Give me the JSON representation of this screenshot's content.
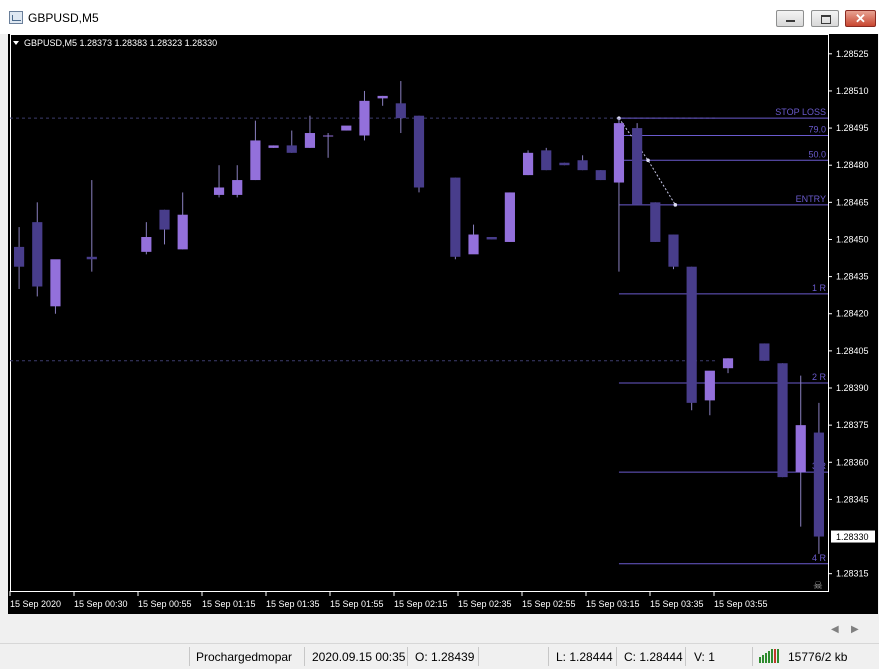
{
  "window": {
    "title": "GBPUSD,M5"
  },
  "symbol_info": "GBPUSD,M5  1.28373 1.28383 1.28323 1.28330",
  "colors": {
    "bg": "#000000",
    "bull": "#9370db",
    "bear": "#483d8b",
    "wick": "#8a80c0",
    "fib": "#6a5acd",
    "axis": "#ffffff",
    "grid": "#3c3c6e"
  },
  "status": {
    "profile": "Prochargedmopar",
    "datetime": "2020.09.15 00:35",
    "open": "O: 1.28439",
    "high": "",
    "low": "L: 1.28444",
    "close": "C: 1.28444",
    "volume": "V: 1",
    "traffic": "15776/2 kb"
  },
  "chart_data": {
    "type": "candlestick",
    "ylim": [
      1.28308,
      1.28533
    ],
    "y_ticks": [
      "1.28525",
      "1.28510",
      "1.28495",
      "1.28480",
      "1.28465",
      "1.28450",
      "1.28435",
      "1.28420",
      "1.28405",
      "1.28390",
      "1.28375",
      "1.28360",
      "1.28345",
      "1.28315"
    ],
    "current_price": "1.28330",
    "x_labels": [
      "15 Sep 2020",
      "15 Sep 00:30",
      "15 Sep 00:55",
      "15 Sep 01:15",
      "15 Sep 01:35",
      "15 Sep 01:55",
      "15 Sep 02:15",
      "15 Sep 02:35",
      "15 Sep 02:55",
      "15 Sep 03:15",
      "15 Sep 03:35",
      "15 Sep 03:55"
    ],
    "bar_count": 45,
    "candles": [
      [
        0,
        1.28447,
        1.28455,
        1.2843,
        1.28439
      ],
      [
        1,
        1.28457,
        1.28465,
        1.28427,
        1.28431
      ],
      [
        2,
        1.28423,
        1.28426,
        1.2842,
        1.28442
      ],
      [
        4,
        1.28443,
        1.28474,
        1.28437,
        1.28442
      ],
      [
        7,
        1.28445,
        1.28457,
        1.28444,
        1.28451
      ],
      [
        8,
        1.28462,
        1.28462,
        1.28448,
        1.28454
      ],
      [
        9,
        1.28446,
        1.28469,
        1.28446,
        1.2846
      ],
      [
        11,
        1.28468,
        1.2848,
        1.28467,
        1.28471
      ],
      [
        12,
        1.28468,
        1.2848,
        1.28467,
        1.28474
      ],
      [
        13,
        1.28474,
        1.28498,
        1.28474,
        1.2849
      ],
      [
        14,
        1.28487,
        1.28488,
        1.28487,
        1.28488
      ],
      [
        15,
        1.28488,
        1.28494,
        1.28485,
        1.28485
      ],
      [
        16,
        1.28487,
        1.285,
        1.28487,
        1.28493
      ],
      [
        17,
        1.28492,
        1.28493,
        1.28483,
        1.28492
      ],
      [
        18,
        1.28494,
        1.28495,
        1.28494,
        1.28496
      ],
      [
        19,
        1.28492,
        1.2851,
        1.2849,
        1.28506
      ],
      [
        20,
        1.28507,
        1.28508,
        1.28504,
        1.28508
      ],
      [
        21,
        1.28505,
        1.28514,
        1.28493,
        1.28499
      ],
      [
        22,
        1.285,
        1.285,
        1.28469,
        1.28471
      ],
      [
        24,
        1.28475,
        1.28475,
        1.28442,
        1.28443
      ],
      [
        25,
        1.28444,
        1.28456,
        1.28445,
        1.28452
      ],
      [
        26,
        1.28451,
        1.28451,
        1.2845,
        1.2845
      ],
      [
        27,
        1.28449,
        1.28469,
        1.28449,
        1.28469
      ],
      [
        28,
        1.28476,
        1.28486,
        1.28476,
        1.28485
      ],
      [
        29,
        1.28486,
        1.28487,
        1.28478,
        1.28478
      ],
      [
        30,
        1.28481,
        1.28481,
        1.2848,
        1.2848
      ],
      [
        31,
        1.28482,
        1.28484,
        1.28478,
        1.28478
      ],
      [
        32,
        1.28478,
        1.28478,
        1.28474,
        1.28474
      ],
      [
        33,
        1.28473,
        1.28499,
        1.28437,
        1.28497
      ],
      [
        34,
        1.28495,
        1.28497,
        1.28464,
        1.28464
      ],
      [
        35,
        1.28465,
        1.28465,
        1.28449,
        1.28449
      ],
      [
        36,
        1.28452,
        1.28452,
        1.28438,
        1.28439
      ],
      [
        37,
        1.28439,
        1.28439,
        1.28381,
        1.28384
      ],
      [
        38,
        1.28385,
        1.28396,
        1.28379,
        1.28397
      ],
      [
        39,
        1.28398,
        1.28402,
        1.28396,
        1.28402
      ],
      [
        41,
        1.28408,
        1.28408,
        1.28401,
        1.28401
      ],
      [
        42,
        1.284,
        1.284,
        1.28354,
        1.28354
      ],
      [
        43,
        1.28356,
        1.28395,
        1.28334,
        1.28375
      ],
      [
        44,
        1.28372,
        1.28384,
        1.28323,
        1.2833
      ]
    ],
    "fib_levels": [
      {
        "label": "STOP LOSS",
        "price": 1.28499,
        "x_from": 33
      },
      {
        "label": "79.0",
        "price": 1.28492,
        "x_from": 33
      },
      {
        "label": "50.0",
        "price": 1.28482,
        "x_from": 33
      },
      {
        "label": "ENTRY",
        "price": 1.28464,
        "x_from": 33
      },
      {
        "label": "1  R",
        "price": 1.28428,
        "x_from": 33
      },
      {
        "label": "2  R",
        "price": 1.28392,
        "x_from": 33
      },
      {
        "label": "3  R",
        "price": 1.28356,
        "x_from": 33
      },
      {
        "label": "4  R",
        "price": 1.28319,
        "x_from": 33
      }
    ],
    "guide_lines": [
      1.28499,
      1.28401
    ],
    "swing_path": [
      [
        33,
        1.28499
      ],
      [
        34.6,
        1.28482
      ],
      [
        36.1,
        1.28464
      ]
    ]
  }
}
